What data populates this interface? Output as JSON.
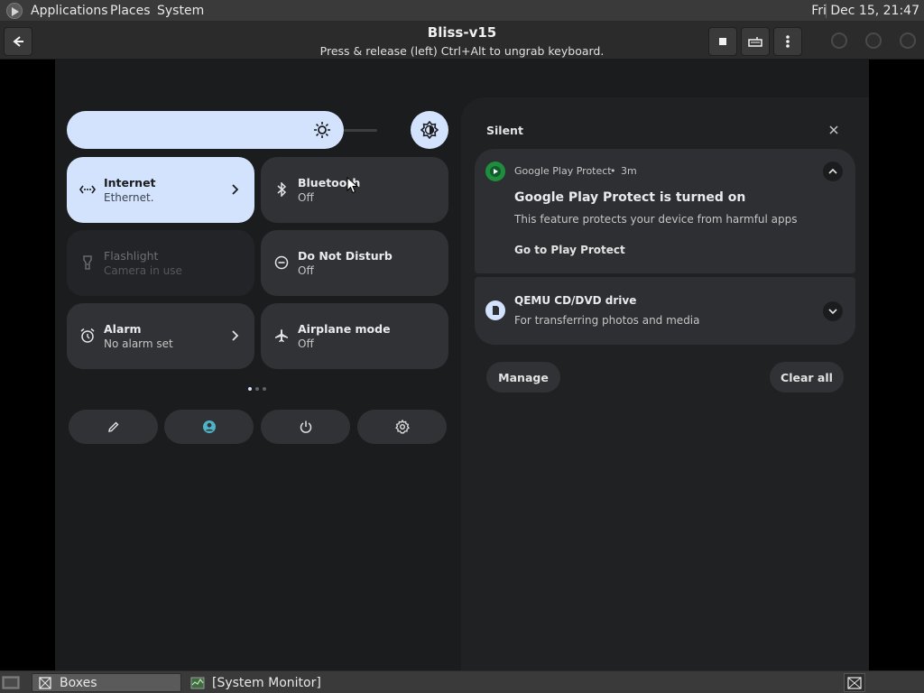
{
  "top_panel": {
    "menus": [
      "Applications",
      "Places",
      "System"
    ],
    "clock": "Fri Dec 15, 21:47"
  },
  "boxes_header": {
    "title": "Bliss-v15",
    "subtitle": "Press & release (left) Ctrl+Alt to ungrab keyboard."
  },
  "quick_settings": {
    "tiles": [
      {
        "title": "Internet",
        "subtitle": "Ethernet.",
        "icon": "ethernet-icon",
        "state": "active",
        "has_chevron": true
      },
      {
        "title": "Bluetooth",
        "subtitle": "Off",
        "icon": "bluetooth-icon",
        "state": "off",
        "has_chevron": false
      },
      {
        "title": "Flashlight",
        "subtitle": "Camera in use",
        "icon": "flashlight-icon",
        "state": "disabled",
        "has_chevron": false
      },
      {
        "title": "Do Not Disturb",
        "subtitle": "Off",
        "icon": "do-not-disturb-icon",
        "state": "off",
        "has_chevron": false
      },
      {
        "title": "Alarm",
        "subtitle": "No alarm set",
        "icon": "alarm-icon",
        "state": "off",
        "has_chevron": true
      },
      {
        "title": "Airplane mode",
        "subtitle": "Off",
        "icon": "airplane-icon",
        "state": "off",
        "has_chevron": false
      }
    ],
    "page_indicator": {
      "pages": 3,
      "current": 1
    },
    "bottom_buttons": [
      "edit-icon",
      "user-icon",
      "power-icon",
      "settings-icon"
    ]
  },
  "notifications": {
    "section_label": "Silent",
    "items": [
      {
        "app": "Google Play Protect",
        "time": "3m",
        "separator": "•",
        "title": "Google Play Protect is turned on",
        "body": "This feature protects your device from harmful apps",
        "action": "Go to Play Protect",
        "expanded": true
      },
      {
        "title": "QEMU CD/DVD drive",
        "body": "For transferring photos and media",
        "expanded": false
      }
    ],
    "manage_label": "Manage",
    "clear_all_label": "Clear all"
  },
  "taskbar": {
    "tasks": [
      "Boxes",
      "[System Monitor]"
    ]
  },
  "colors": {
    "accent_tile": "#d3e3fd",
    "tile_bg": "#303235",
    "panel_bg": "#1f2123",
    "play_protect_green": "#1e8e3e",
    "teal_user": "#4fb3c8"
  }
}
